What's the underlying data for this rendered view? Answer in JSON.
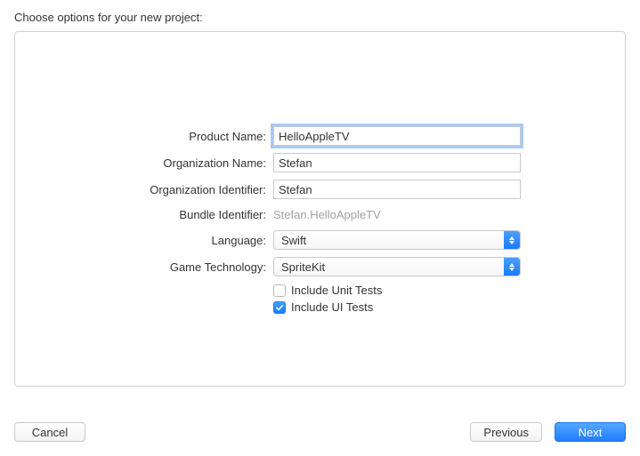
{
  "header": {
    "title": "Choose options for your new project:"
  },
  "form": {
    "product_name": {
      "label": "Product Name:",
      "value": "HelloAppleTV"
    },
    "organization_name": {
      "label": "Organization Name:",
      "value": "Stefan"
    },
    "organization_identifier": {
      "label": "Organization Identifier:",
      "value": "Stefan"
    },
    "bundle_identifier": {
      "label": "Bundle Identifier:",
      "value": "Stefan.HelloAppleTV"
    },
    "language": {
      "label": "Language:",
      "value": "Swift"
    },
    "game_technology": {
      "label": "Game Technology:",
      "value": "SpriteKit"
    },
    "include_unit_tests": {
      "label": "Include Unit Tests",
      "checked": false
    },
    "include_ui_tests": {
      "label": "Include UI Tests",
      "checked": true
    }
  },
  "buttons": {
    "cancel": "Cancel",
    "previous": "Previous",
    "next": "Next"
  }
}
